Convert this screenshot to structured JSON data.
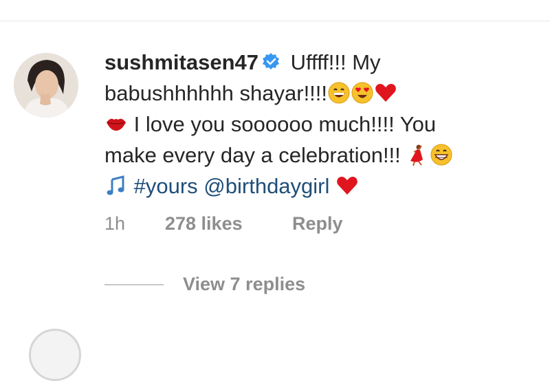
{
  "comment": {
    "username": "sushmitasen47",
    "text_line1": " Uffff!!! My",
    "text_line2": "babushhhhhh shayar!!!!",
    "text_line3": " I love you soooooo much!!!! You",
    "text_line4": "make every day a celebration!!! ",
    "hashtag": "#yours",
    "mention": "@birthdaygirl",
    "icons": [
      "verified-badge-icon",
      "grinning-face-icon",
      "heart-eyes-icon",
      "red-heart-icon",
      "lips-icon",
      "dancer-icon",
      "beaming-face-icon",
      "music-note-icon"
    ]
  },
  "meta": {
    "time": "1h",
    "likes": "278 likes",
    "reply": "Reply"
  },
  "replies": {
    "label": "View 7 replies"
  },
  "colors": {
    "verified": "#3897f0",
    "heart": "#e0161e",
    "link": "#1f4e79",
    "muted": "#8e8e8e"
  }
}
